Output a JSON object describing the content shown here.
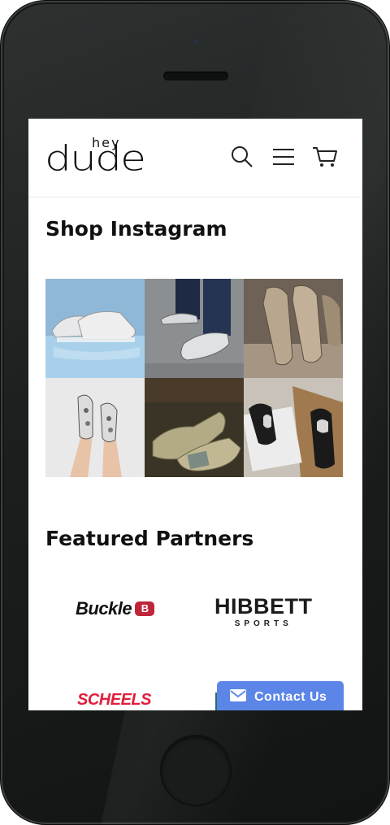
{
  "brand": {
    "logo_small": "hey",
    "logo_big": "dude"
  },
  "header": {
    "icons": [
      "search-icon",
      "menu-icon",
      "cart-icon"
    ]
  },
  "instagram": {
    "title": "Shop Instagram",
    "tiles": [
      "white-slip-on-shoes-on-water",
      "grey-shoes-with-jeans",
      "tan-suede-shoes-pair",
      "patterned-shoes-on-feet",
      "olive-knit-sneakers",
      "black-shoes-in-box"
    ]
  },
  "partners": {
    "title": "Featured Partners",
    "buckle": "Buckle",
    "buckle_mark": "B",
    "hibbett_main": "HIBBETT",
    "hibbett_sub": "SPORTS",
    "scheels": "SCHEELS"
  },
  "contact": {
    "label": "Contact Us",
    "color": "#5b86e8"
  }
}
